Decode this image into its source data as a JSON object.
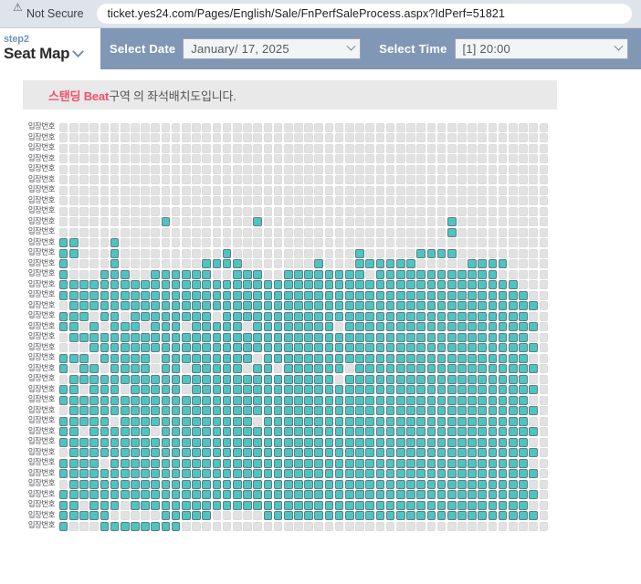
{
  "browser": {
    "security_label": "Not Secure",
    "security_icon": "warning-triangle-icon",
    "url": "ticket.yes24.com/Pages/English/Sale/FnPerfSaleProcess.aspx?IdPerf=51821"
  },
  "stepbar": {
    "step_number": "step2",
    "step_title": "Seat Map",
    "step_chevron_icon": "chevron-down-icon",
    "date_label": "Select Date",
    "date_value": "January/ 17, 2025",
    "time_label": "Select Time",
    "time_value": "[1] 20:00",
    "bar_color": "#8097b5"
  },
  "notice": {
    "highlight": "스탠딩 Beat",
    "rest": "구역 의 좌석배치도입니다.",
    "highlight_color": "#f0516a",
    "background": "#e9e9e9"
  },
  "seatmap": {
    "row_label": "입장번호",
    "rows": 39,
    "cols": 48,
    "seat_available_color": "#e2e2e2",
    "seat_taken_color": "#4fc3c0",
    "seat_taken_border": "#5e7d85",
    "grid": [
      "000000000000000000000000000000000000000000000000",
      "000000000000000000000000000000000000000000000000",
      "000000000000000000000000000000000000000000000000",
      "000000000000000000000000000000000000000000000000",
      "000000000000000000000000000000000000000000000000",
      "000000000000000000000000000000000000000000000000",
      "000000000000000000000000000000000000000000000000",
      "000000000000000000000000000000000000000000000000",
      "000000000000000000000000000000000000000000000000",
      "000000000010000000010000000000000000001000000000",
      "000000000000000000000000000000000000001000000000",
      "110001000000000000000000000000000000000000000000",
      "110001000000000010000000000001000001111000000000",
      "100001000000001111000000010001111110000011110000",
      "100011100111111001110011111111011111111111100000",
      "111111111111111111111111111111111111111111111000",
      "111111111111111111111111111111111111111111111100",
      "011111111111111111111111111111111111111111111110",
      "111011011111111011111111111111111111111111111100",
      "110101110111011111011111111011111111111111111110",
      "011111111111111111111111111111111111111111111100",
      "000111111111111111111111111111111111111111111110",
      "111011111011111111101111111111111111111111111100",
      "101101111011011111011011111101111111111111111110",
      "011111111111111111111111111011111111111111111100",
      "110111011111011111111111111111111111111111111110",
      "111111111111111111111111111111111111111111111100",
      "011111111111111111111111111111111111111111111110",
      "111110111111111111101111111111111111111111111100",
      "110111111011111111111111111111111111111111111110",
      "111111111111111111111111111111111111111111111100",
      "011111111111111111111111111111111111111111111110",
      "111101111111111111111111111111111111111111111100",
      "111111111111111111111111111111111111111111111110",
      "011111111111111111111111111111111111111111111100",
      "111111111111111111111111111111111111111111111110",
      "110111011111111111111111111111111111111111111100",
      "111110000011111000001111111111111111111111111110",
      "100011111111000000000000000000000000000000000000"
    ]
  }
}
